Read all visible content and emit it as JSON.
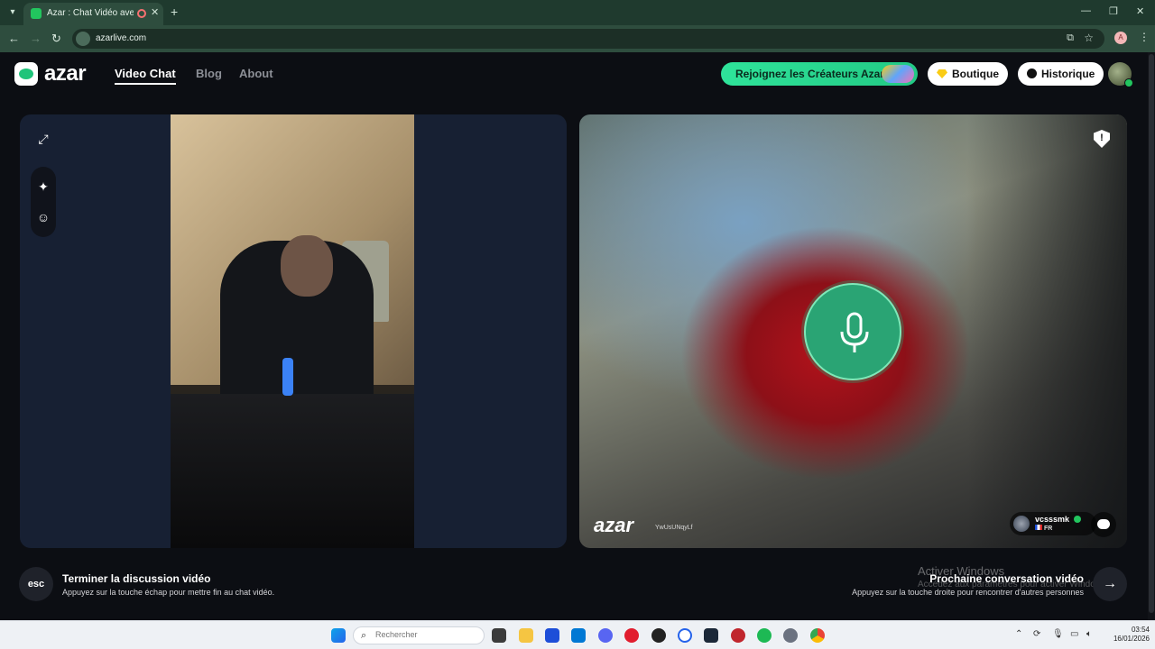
{
  "browser": {
    "tab_title": "Azar : Chat Vidéo avec de n",
    "tab_close": "✕",
    "new_tab": "+",
    "url": "azarlive.com",
    "profile_initial": "A",
    "window_controls": [
      "—",
      "❐",
      "✕"
    ]
  },
  "header": {
    "logo": "azar",
    "nav": [
      "Video Chat",
      "Blog",
      "About"
    ],
    "active_nav": "Video Chat",
    "creators_button": "Rejoignez les Créateurs Azar",
    "shop_button": "Boutique",
    "history_button": "Historique"
  },
  "remote": {
    "watermark": "azar",
    "watermark_id": "YwUsUNqyLf",
    "username": "vcsssmk",
    "country": "FR"
  },
  "hints": {
    "esc_key": "esc",
    "end_title": "Terminer la discussion vidéo",
    "end_sub": "Appuyez sur la touche échap pour mettre fin au chat vidéo.",
    "next_title": "Prochaine conversation vidéo",
    "next_sub": "Appuyez sur la touche droite pour rencontrer d'autres personnes",
    "next_key": "→"
  },
  "windows_activation": {
    "line1": "Activer Windows",
    "line2": "Accédez aux paramètres pour activer Windows."
  },
  "taskbar": {
    "search_placeholder": "Rechercher",
    "time": "03:54",
    "date": "16/01/2026"
  },
  "colors": {
    "accent": "#22c984",
    "mic_bg": "#2aa474",
    "page_bg": "#0c0e13",
    "browser_frame": "#2e4d3e"
  }
}
